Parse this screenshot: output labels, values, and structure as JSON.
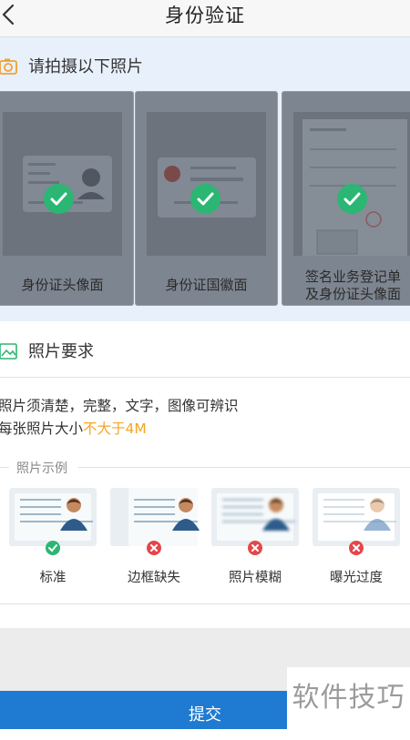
{
  "header": {
    "title": "身份验证"
  },
  "photo_section": {
    "title": "请拍摄以下照片",
    "cards": [
      {
        "caption": "身份证头像面"
      },
      {
        "caption": "身份证国徽面"
      },
      {
        "caption_line1": "签名业务登记单",
        "caption_line2": "及身份证头像面"
      }
    ]
  },
  "requirements": {
    "title": "照片要求",
    "line1": "照片须清楚，完整，文字，图像可辨识",
    "line2_prefix": "每张照片大小",
    "line2_highlight": "不大于4M"
  },
  "examples": {
    "title": "照片示例",
    "items": [
      {
        "label": "标准",
        "status": "ok"
      },
      {
        "label": "边框缺失",
        "status": "bad"
      },
      {
        "label": "照片模糊",
        "status": "bad"
      },
      {
        "label": "曝光过度",
        "status": "bad"
      }
    ]
  },
  "submit_label": "提交",
  "watermark": "软件技巧",
  "colors": {
    "accent": "#1f7bd1",
    "success": "#2bb673",
    "error": "#e4474b",
    "warning": "#f5a623"
  },
  "icons": [
    "back-arrow-icon",
    "camera-icon",
    "image-icon",
    "checkmark-icon",
    "cross-icon"
  ]
}
